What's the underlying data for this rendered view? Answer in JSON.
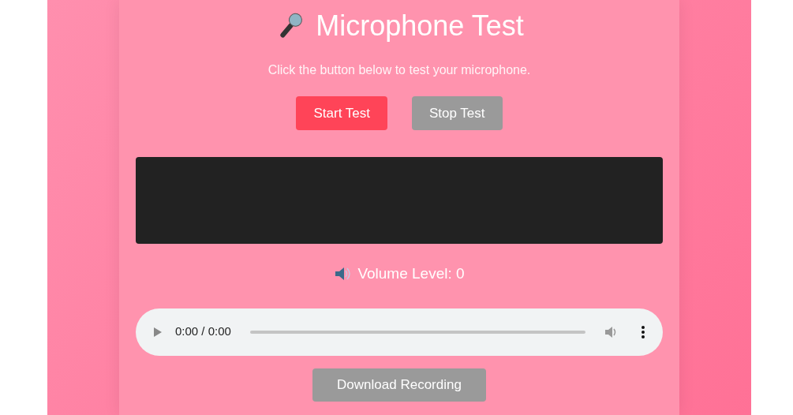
{
  "title": "Microphone Test",
  "subtitle": "Click the button below to test your microphone.",
  "buttons": [
    {
      "label": "Start Test",
      "disabled": false
    },
    {
      "label": "Stop Test",
      "disabled": true
    }
  ],
  "volume_label": "Volume Level: 0",
  "audio_player": {
    "time": "0:00 / 0:00"
  },
  "download_button": {
    "label": "Download Recording",
    "disabled": true
  }
}
